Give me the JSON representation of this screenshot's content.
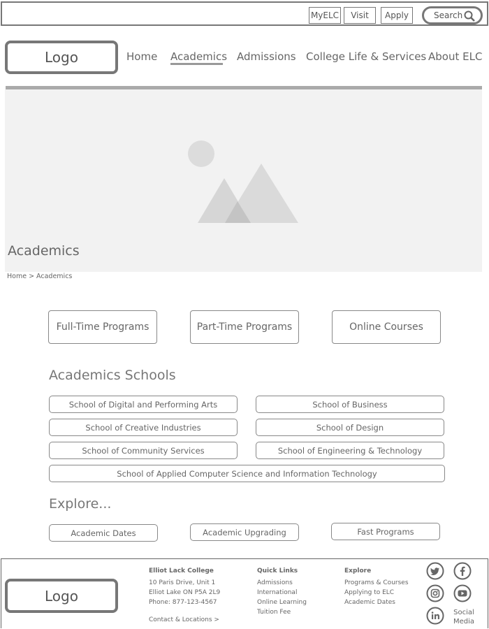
{
  "utility_bar": {
    "myelc": "MyELC",
    "visit": "Visit",
    "apply": "Apply",
    "search_label": "Search",
    "search_icon": "magnifier-icon"
  },
  "header": {
    "logo": "Logo",
    "nav": [
      "Home",
      "Academics",
      "Admissions",
      "College Life & Services",
      "About ELC"
    ],
    "active_nav": "Academics"
  },
  "hero": {
    "image_icon": "image-placeholder-icon",
    "title": "Academics"
  },
  "breadcrumb": "Home > Academics",
  "programs": [
    "Full-Time Programs",
    "Part-Time Programs",
    "Online Courses"
  ],
  "schools": {
    "title": "Academics Schools",
    "items": [
      "School of Digital and Performing Arts",
      "School of Business",
      "School of Creative Industries",
      "School of Design",
      "School of Community Services",
      "School of Engineering & Technology",
      "School of Applied Computer Science and Information Technology"
    ]
  },
  "explore": {
    "title": "Explore...",
    "items": [
      "Academic Dates",
      "Academic Upgrading",
      "Fast Programs"
    ]
  },
  "footer": {
    "logo": "Logo",
    "college": {
      "name": "Elliot Lack College",
      "address1": "10 Paris Drive, Unit 1",
      "address2": "Elliot Lake ON P5A 2L9",
      "phone": "Phone: 877-123-4567",
      "contact": "Contact & Locations >"
    },
    "quick_links": {
      "title": "Quick Links",
      "items": [
        "Admissions",
        "International",
        "Online Learning",
        "Tuition Fee"
      ]
    },
    "explore": {
      "title": "Explore",
      "items": [
        "Programs & Courses",
        "Applying to ELC",
        "Academic Dates"
      ]
    },
    "social": {
      "icons": [
        "twitter-icon",
        "facebook-icon",
        "instagram-icon",
        "youtube-icon",
        "linkedin-icon"
      ],
      "label": "Social Media"
    }
  },
  "colors": {
    "border": "#777777",
    "text": "#666666",
    "hero_bg": "#f2f2f2",
    "placeholder_shape": "#d9d9d9"
  }
}
